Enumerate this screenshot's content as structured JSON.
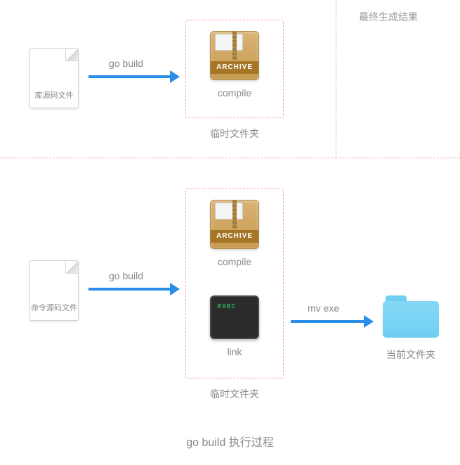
{
  "title": "go build 执行过程",
  "top_right_label": "最终生成结果",
  "top": {
    "file_label": "库源码文件",
    "arrow_label": "go build",
    "archive_band": "ARCHIVE",
    "archive_caption": "compile",
    "box_label": "临时文件夹"
  },
  "bottom": {
    "file_label": "命令源码文件",
    "arrow1_label": "go build",
    "archive_band": "ARCHIVE",
    "archive_caption": "compile",
    "exec_text": "exec",
    "exec_caption": "link",
    "box_label": "临时文件夹",
    "arrow2_label": "mv exe",
    "folder_label": "当前文件夹"
  }
}
